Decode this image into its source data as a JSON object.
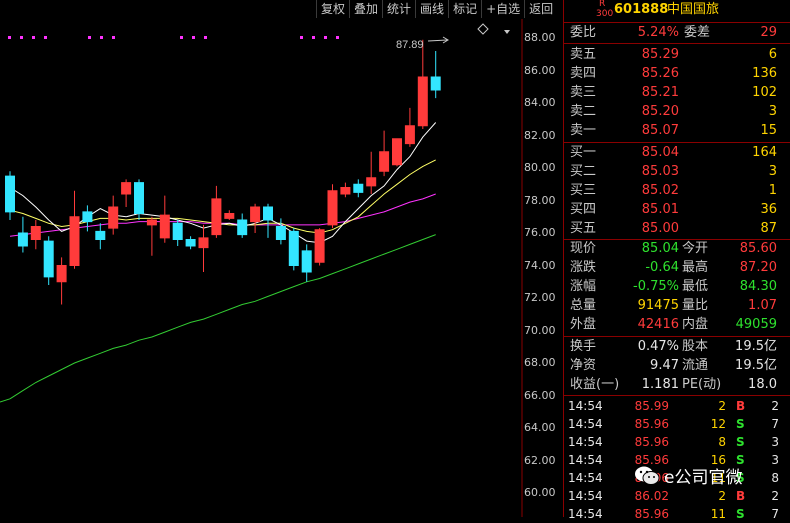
{
  "toolbar": {
    "buttons": [
      "复权",
      "叠加",
      "统计",
      "画线",
      "标记",
      "+自选",
      "返回"
    ]
  },
  "chart_data": {
    "type": "candlestick",
    "ylim": [
      58.6,
      89.0
    ],
    "yticks": [
      "88.00",
      "86.00",
      "84.00",
      "82.00",
      "80.00",
      "78.00",
      "76.00",
      "74.00",
      "72.00",
      "70.00",
      "68.00",
      "66.00",
      "64.00",
      "62.00",
      "60.00"
    ],
    "annotation": "87.89",
    "colors": {
      "up": "#ff3b3b",
      "down": "#33e6ff",
      "ma5": "#ffffff",
      "ma10": "#ffff66",
      "ma20": "#ff33ff",
      "ma60": "#33cc33"
    },
    "candles": [
      {
        "o": 79.5,
        "c": 77.3,
        "h": 79.8,
        "l": 76.8
      },
      {
        "o": 76.0,
        "c": 75.2,
        "h": 77.0,
        "l": 74.8
      },
      {
        "o": 75.6,
        "c": 76.4,
        "h": 76.8,
        "l": 75.0
      },
      {
        "o": 75.5,
        "c": 73.3,
        "h": 75.8,
        "l": 72.8
      },
      {
        "o": 73.0,
        "c": 74.0,
        "h": 74.5,
        "l": 71.6
      },
      {
        "o": 74.0,
        "c": 77.0,
        "h": 78.6,
        "l": 73.8
      },
      {
        "o": 77.3,
        "c": 76.7,
        "h": 77.7,
        "l": 76.1
      },
      {
        "o": 76.1,
        "c": 75.6,
        "h": 76.6,
        "l": 75.0
      },
      {
        "o": 76.3,
        "c": 77.6,
        "h": 78.3,
        "l": 75.9
      },
      {
        "o": 78.4,
        "c": 79.1,
        "h": 79.3,
        "l": 77.6
      },
      {
        "o": 79.1,
        "c": 77.2,
        "h": 79.3,
        "l": 76.8
      },
      {
        "o": 76.5,
        "c": 76.8,
        "h": 77.0,
        "l": 74.6
      },
      {
        "o": 75.7,
        "c": 77.1,
        "h": 78.3,
        "l": 75.4
      },
      {
        "o": 76.6,
        "c": 75.6,
        "h": 76.8,
        "l": 75.2
      },
      {
        "o": 75.6,
        "c": 75.2,
        "h": 75.8,
        "l": 75.0
      },
      {
        "o": 75.1,
        "c": 75.7,
        "h": 76.5,
        "l": 73.6
      },
      {
        "o": 75.9,
        "c": 78.1,
        "h": 78.9,
        "l": 75.7
      },
      {
        "o": 76.9,
        "c": 77.2,
        "h": 77.4,
        "l": 76.8
      },
      {
        "o": 76.8,
        "c": 75.9,
        "h": 77.2,
        "l": 75.7
      },
      {
        "o": 76.7,
        "c": 77.6,
        "h": 77.8,
        "l": 76.0
      },
      {
        "o": 77.6,
        "c": 76.8,
        "h": 77.8,
        "l": 75.7
      },
      {
        "o": 76.4,
        "c": 75.6,
        "h": 76.9,
        "l": 75.3
      },
      {
        "o": 76.1,
        "c": 74.0,
        "h": 76.3,
        "l": 73.7
      },
      {
        "o": 74.9,
        "c": 73.6,
        "h": 75.3,
        "l": 73.0
      },
      {
        "o": 74.2,
        "c": 76.2,
        "h": 76.3,
        "l": 74.0
      },
      {
        "o": 76.5,
        "c": 78.6,
        "h": 79.0,
        "l": 76.3
      },
      {
        "o": 78.4,
        "c": 78.8,
        "h": 79.1,
        "l": 78.2
      },
      {
        "o": 79.0,
        "c": 78.5,
        "h": 79.3,
        "l": 78.2
      },
      {
        "o": 78.9,
        "c": 79.4,
        "h": 81.0,
        "l": 78.4
      },
      {
        "o": 79.8,
        "c": 81.0,
        "h": 82.3,
        "l": 79.5
      },
      {
        "o": 80.2,
        "c": 81.8,
        "h": 81.8,
        "l": 80.1
      },
      {
        "o": 81.5,
        "c": 82.6,
        "h": 83.7,
        "l": 81.3
      },
      {
        "o": 82.6,
        "c": 85.6,
        "h": 87.89,
        "l": 82.4
      },
      {
        "o": 85.6,
        "c": 84.8,
        "h": 87.2,
        "l": 84.3
      }
    ],
    "ma5": [
      78.8,
      78.3,
      77.6,
      76.8,
      76.1,
      76.4,
      77.0,
      77.5,
      77.1,
      77.0,
      77.2,
      77.1,
      77.0,
      76.8,
      76.6,
      76.3,
      76.5,
      76.6,
      76.4,
      76.6,
      76.9,
      76.5,
      76.0,
      75.5,
      75.4,
      75.8,
      76.7,
      77.5,
      78.3,
      78.9,
      79.9,
      80.7,
      81.9,
      82.8
    ],
    "ma10": [
      77.4,
      77.2,
      76.9,
      76.6,
      76.4,
      76.5,
      76.7,
      76.9,
      76.9,
      76.8,
      76.9,
      76.9,
      76.9,
      76.9,
      76.8,
      76.7,
      76.6,
      76.5,
      76.5,
      76.5,
      76.6,
      76.6,
      76.3,
      76.1,
      76.0,
      76.2,
      76.6,
      77.0,
      77.7,
      78.4,
      79.0,
      79.6,
      80.1,
      80.5
    ],
    "ma20": [
      75.8,
      75.9,
      76.0,
      76.1,
      76.2,
      76.3,
      76.4,
      76.5,
      76.6,
      76.6,
      76.7,
      76.7,
      76.7,
      76.7,
      76.7,
      76.6,
      76.6,
      76.6,
      76.5,
      76.5,
      76.5,
      76.5,
      76.5,
      76.5,
      76.5,
      76.6,
      76.7,
      76.9,
      77.1,
      77.3,
      77.6,
      77.9,
      78.1,
      78.4
    ],
    "ma60": [
      65.8,
      66.3,
      66.8,
      67.2,
      67.6,
      68.0,
      68.3,
      68.6,
      68.9,
      69.1,
      69.4,
      69.6,
      69.9,
      70.2,
      70.5,
      70.7,
      71.0,
      71.3,
      71.6,
      71.8,
      72.1,
      72.4,
      72.7,
      73.0,
      73.2,
      73.5,
      73.8,
      74.1,
      74.4,
      74.7,
      75.0,
      75.3,
      75.6,
      75.9
    ]
  },
  "quote": {
    "badge_top": "R",
    "badge_bottom": "300",
    "code": "601888",
    "name": "中国国旅",
    "weibi_label": "委比",
    "weibi_value": "5.24%",
    "weicha_label": "委差",
    "weicha_value": "29",
    "asks": [
      {
        "label": "卖五",
        "price": "85.29",
        "vol": "6"
      },
      {
        "label": "卖四",
        "price": "85.26",
        "vol": "136"
      },
      {
        "label": "卖三",
        "price": "85.21",
        "vol": "102"
      },
      {
        "label": "卖二",
        "price": "85.20",
        "vol": "3"
      },
      {
        "label": "卖一",
        "price": "85.07",
        "vol": "15"
      }
    ],
    "bids": [
      {
        "label": "买一",
        "price": "85.04",
        "vol": "164"
      },
      {
        "label": "买二",
        "price": "85.03",
        "vol": "3"
      },
      {
        "label": "买三",
        "price": "85.02",
        "vol": "1"
      },
      {
        "label": "买四",
        "price": "85.01",
        "vol": "36"
      },
      {
        "label": "买五",
        "price": "85.00",
        "vol": "87"
      }
    ],
    "stats": [
      {
        "l1": "现价",
        "v1": "85.04",
        "c1": "green",
        "l2": "今开",
        "v2": "85.60",
        "c2": "red"
      },
      {
        "l1": "涨跌",
        "v1": "-0.64",
        "c1": "green",
        "l2": "最高",
        "v2": "87.20",
        "c2": "red"
      },
      {
        "l1": "涨幅",
        "v1": "-0.75%",
        "c1": "green",
        "l2": "最低",
        "v2": "84.30",
        "c2": "green"
      },
      {
        "l1": "总量",
        "v1": "91475",
        "c1": "yellow",
        "l2": "量比",
        "v2": "1.07",
        "c2": "red"
      },
      {
        "l1": "外盘",
        "v1": "42416",
        "c1": "red",
        "l2": "内盘",
        "v2": "49059",
        "c2": "green"
      }
    ],
    "fund": [
      {
        "l1": "换手",
        "v1": "0.47%",
        "l2": "股本",
        "v2": "19.5亿"
      },
      {
        "l1": "净资",
        "v1": "9.47",
        "l2": "流通",
        "v2": "19.5亿"
      },
      {
        "l1": "收益(一)",
        "v1": "1.181",
        "l2": "PE(动)",
        "v2": "18.0"
      }
    ],
    "ticks": [
      {
        "time": "14:54",
        "price": "85.99",
        "vol": "2",
        "bs": "B",
        "n": "2",
        "pc": "red",
        "bc": "red"
      },
      {
        "time": "14:54",
        "price": "85.96",
        "vol": "12",
        "bs": "S",
        "n": "7",
        "pc": "red",
        "bc": "green"
      },
      {
        "time": "14:54",
        "price": "85.96",
        "vol": "8",
        "bs": "S",
        "n": "3",
        "pc": "red",
        "bc": "green"
      },
      {
        "time": "14:54",
        "price": "85.96",
        "vol": "16",
        "bs": "S",
        "n": "3",
        "pc": "red",
        "bc": "green"
      },
      {
        "time": "14:54",
        "price": "85.96",
        "vol": "11",
        "bs": "S",
        "n": "8",
        "pc": "red",
        "bc": "green"
      },
      {
        "time": "14:54",
        "price": "86.02",
        "vol": "2",
        "bs": "B",
        "n": "2",
        "pc": "red",
        "bc": "red"
      },
      {
        "time": "14:54",
        "price": "85.96",
        "vol": "11",
        "bs": "S",
        "n": "7",
        "pc": "red",
        "bc": "green"
      }
    ]
  },
  "watermark": {
    "text": "e公司官微",
    "icon": "wechat-icon"
  }
}
